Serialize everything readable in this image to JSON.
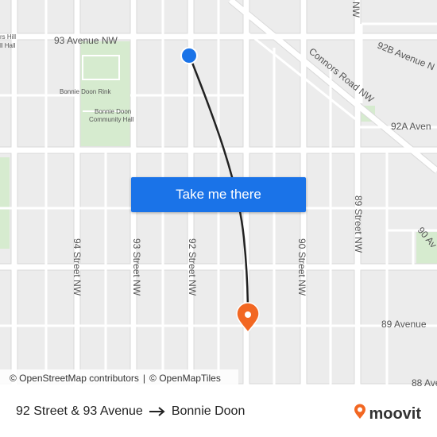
{
  "map": {
    "street_labels": {
      "ave_93": "93 Avenue NW",
      "connors": "Connors Road NW",
      "ave_92b": "92B Avenue N",
      "ave_92a": "92A Aven",
      "st_94": "94 Street NW",
      "st_93": "93 Street NW",
      "st_92": "92 Street NW",
      "st_90": "90 Street NW",
      "st_89": "89 Street NW",
      "ave_90": "90 Av",
      "ave_89": "89 Avenue",
      "ave_88": "88 Ave",
      "partial_nw": "NW",
      "partial_hall_1": "rs Hill",
      "partial_hall_2": "ll Hall"
    },
    "poi_labels": {
      "rink": "Bonnie Doon Rink",
      "hall_1": "Bonnie Doon",
      "hall_2": "Community Hall"
    },
    "colors": {
      "route_line": "#222222",
      "origin_marker": "#1a73e8",
      "destination_marker": "#f26722",
      "park": "#d4ebd0",
      "road": "#ffffff"
    }
  },
  "cta": {
    "label": "Take me there"
  },
  "attribution": {
    "osm_contributors": "© OpenStreetMap contributors",
    "separator": "|",
    "openmaptiles": "© OpenMapTiles"
  },
  "route": {
    "origin": "92 Street & 93 Avenue",
    "destination": "Bonnie Doon"
  },
  "brand": {
    "name": "moovit",
    "color": "#f26722"
  }
}
